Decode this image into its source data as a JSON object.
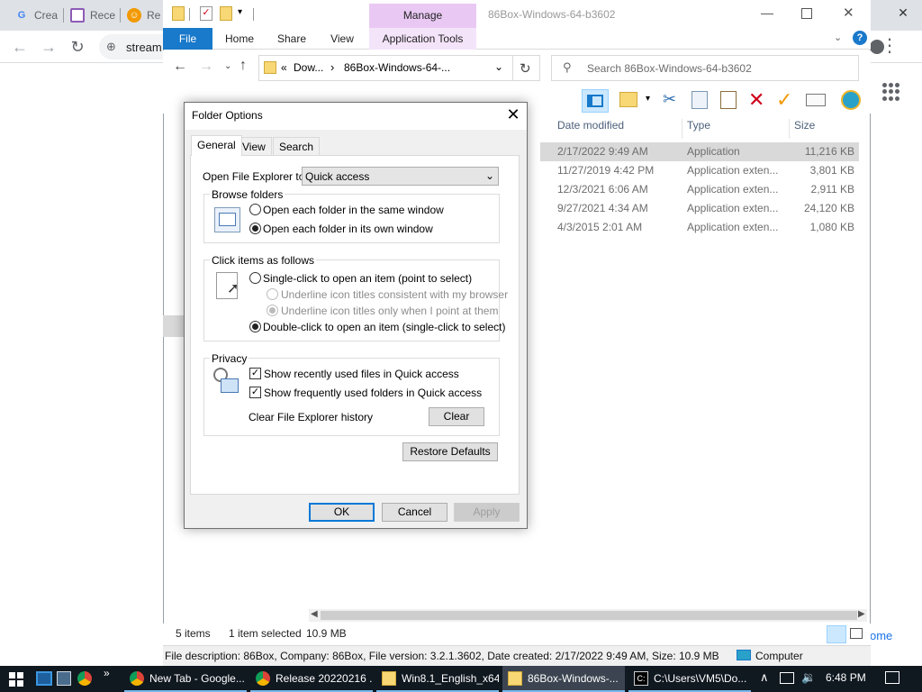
{
  "chrome": {
    "tabs": [
      {
        "label": "Crea",
        "icon": "google-icon"
      },
      {
        "label": "Rece",
        "icon": "doc-icon"
      },
      {
        "label": "Re",
        "icon": "emoji-icon"
      }
    ],
    "omnibox_text": "stream",
    "right_snippet": "ome"
  },
  "explorer": {
    "window_title": "86Box-Windows-64-b3602",
    "manage_label": "Manage",
    "ribbon_tabs": [
      "File",
      "Home",
      "Share",
      "View",
      "Application Tools"
    ],
    "address": {
      "prefix": "«",
      "crumb1": "Dow...",
      "separator": "›",
      "crumb2": "86Box-Windows-64-..."
    },
    "search_placeholder": "Search 86Box-Windows-64-b3602",
    "columns": [
      "Date modified",
      "Type",
      "Size"
    ],
    "files": [
      {
        "date": "2/17/2022 9:49 AM",
        "type": "Application",
        "size": "11,216 KB",
        "selected": true
      },
      {
        "date": "11/27/2019 4:42 PM",
        "type": "Application exten...",
        "size": "3,801 KB",
        "selected": false
      },
      {
        "date": "12/3/2021 6:06 AM",
        "type": "Application exten...",
        "size": "2,911 KB",
        "selected": false
      },
      {
        "date": "9/27/2021 4:34 AM",
        "type": "Application exten...",
        "size": "24,120 KB",
        "selected": false
      },
      {
        "date": "4/3/2015 2:01 AM",
        "type": "Application exten...",
        "size": "1,080 KB",
        "selected": false
      }
    ],
    "status": {
      "items": "5 items",
      "selected": "1 item selected",
      "size": "10.9 MB"
    },
    "infobar": {
      "description": "File description: 86Box, Company: 86Box, File version: 3.2.1.3602, Date created: 2/17/2022 9:49 AM, Size:  10.9 MB",
      "location": "Computer"
    }
  },
  "dialog": {
    "title": "Folder Options",
    "tabs": [
      "General",
      "View",
      "Search"
    ],
    "open_to_label": "Open File Explorer to:",
    "open_to_value": "Quick access",
    "browse": {
      "title": "Browse folders",
      "same_window": "Open each folder in the same window",
      "own_window": "Open each folder in its own window"
    },
    "click": {
      "title": "Click items as follows",
      "single": "Single-click to open an item (point to select)",
      "underline_browser": "Underline icon titles consistent with my browser",
      "underline_point": "Underline icon titles only when I point at them",
      "double": "Double-click to open an item (single-click to select)"
    },
    "privacy": {
      "title": "Privacy",
      "recent_files": "Show recently used files in Quick access",
      "frequent_folders": "Show frequently used folders in Quick access",
      "clear_history": "Clear File Explorer history",
      "clear_button": "Clear"
    },
    "restore_defaults": "Restore Defaults",
    "ok": "OK",
    "cancel": "Cancel",
    "apply": "Apply"
  },
  "taskbar": {
    "tasks": [
      {
        "label": "New Tab - Google...",
        "icon": "chrome-icon"
      },
      {
        "label": "Release 20220216 ...",
        "icon": "chrome-icon"
      },
      {
        "label": "Win8.1_English_x64",
        "icon": "folder-icon"
      },
      {
        "label": "86Box-Windows-...",
        "icon": "folder-icon"
      },
      {
        "label": "C:\\Users\\VM5\\Do...",
        "icon": "cmd-icon"
      }
    ],
    "time": "6:48 PM"
  },
  "colors": {
    "accent": "#0078d7",
    "file_tab": "#1979ca",
    "manage": "#e9c9f4",
    "taskbar": "#101820"
  }
}
